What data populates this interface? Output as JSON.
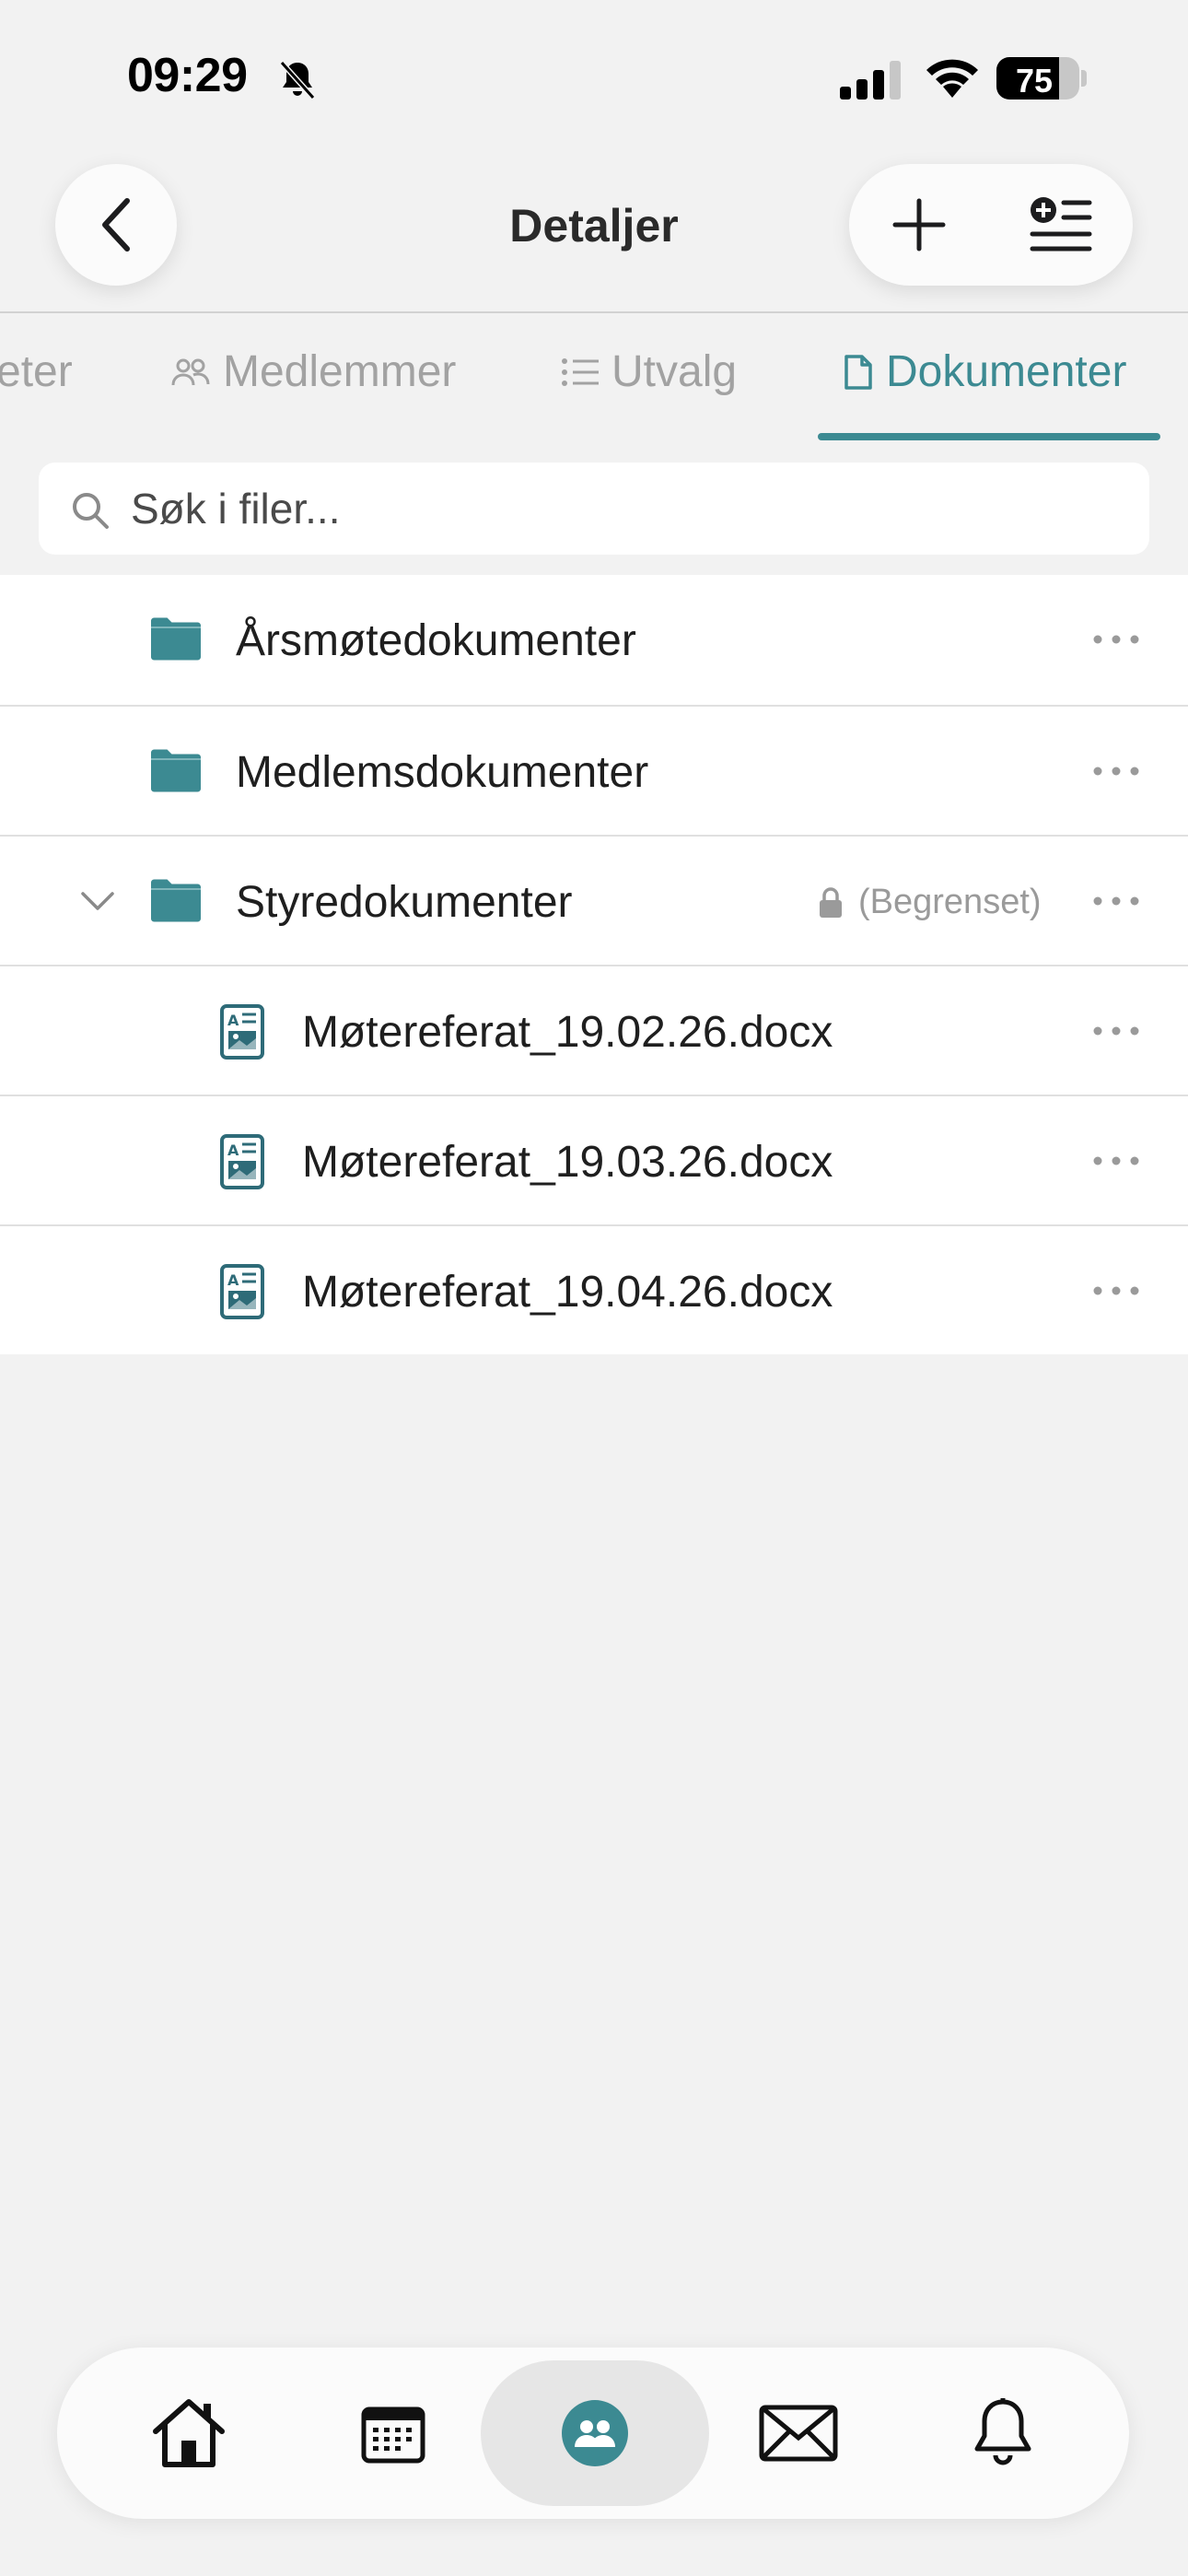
{
  "status_bar": {
    "time": "09:29",
    "battery_percent": "75",
    "battery_level": 0.75
  },
  "nav": {
    "title": "Detaljer",
    "back_icon": "chevron-left-icon",
    "add_icon": "plus-icon",
    "list_add_icon": "list-add-icon"
  },
  "tabs": [
    {
      "label": "eter",
      "icon": ""
    },
    {
      "label": "Medlemmer",
      "icon": "people-icon"
    },
    {
      "label": "Utvalg",
      "icon": "list-icon"
    },
    {
      "label": "Dokumenter",
      "icon": "document-icon",
      "active": true
    }
  ],
  "search": {
    "placeholder": "Søk i filer..."
  },
  "files": [
    {
      "type": "folder",
      "name": "Årsmøtedokumenter"
    },
    {
      "type": "folder",
      "name": "Medlemsdokumenter"
    },
    {
      "type": "folder",
      "name": "Styredokumenter",
      "expanded": true,
      "restricted_label": "(Begrenset)"
    },
    {
      "type": "file",
      "name": "Møtereferat_19.02.26.docx"
    },
    {
      "type": "file",
      "name": "Møtereferat_19.03.26.docx"
    },
    {
      "type": "file",
      "name": "Møtereferat_19.04.26.docx"
    }
  ],
  "bottom_tabs": [
    {
      "icon": "home-icon"
    },
    {
      "icon": "calendar-icon"
    },
    {
      "icon": "group-icon",
      "active": true
    },
    {
      "icon": "mail-icon"
    },
    {
      "icon": "bell-icon"
    }
  ],
  "colors": {
    "accent": "#3c8a92",
    "background": "#f2f2f2",
    "muted": "#a2a2a2"
  }
}
